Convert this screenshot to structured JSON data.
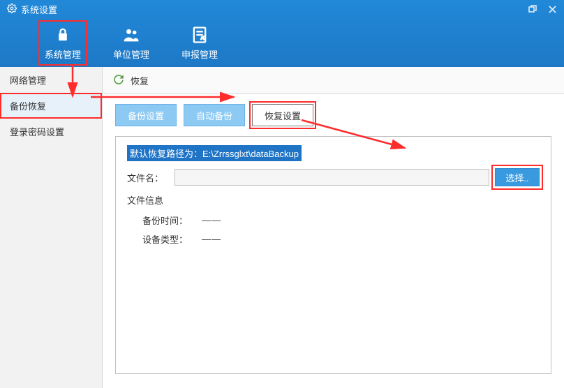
{
  "title": "系统设置",
  "toolbar": [
    {
      "key": "system-manage",
      "label": "系统管理",
      "highlight": true
    },
    {
      "key": "unit-manage",
      "label": "单位管理",
      "highlight": false
    },
    {
      "key": "report-manage",
      "label": "申报管理",
      "highlight": false
    }
  ],
  "sidebar": [
    {
      "key": "network",
      "label": "网络管理",
      "selected": false,
      "highlight": false
    },
    {
      "key": "backup-restore",
      "label": "备份恢复",
      "selected": true,
      "highlight": true
    },
    {
      "key": "password",
      "label": "登录密码设置",
      "selected": false,
      "highlight": false
    }
  ],
  "content_header": {
    "icon": "restore-icon",
    "title": "恢复"
  },
  "tabs": [
    {
      "key": "backup-settings",
      "label": "备份设置",
      "active": false,
      "highlight": false
    },
    {
      "key": "auto-backup",
      "label": "自动备份",
      "active": false,
      "highlight": false
    },
    {
      "key": "restore-settings",
      "label": "恢复设置",
      "active": true,
      "highlight": true
    }
  ],
  "panel": {
    "default_path_text": "默认恢复路径为：E:\\Zrrssglxt\\dataBackup",
    "filename_label": "文件名：",
    "filename_value": "",
    "choose_label": "选择..",
    "file_info_title": "文件信息",
    "backup_time_label": "备份时间：",
    "backup_time_value": "——",
    "device_type_label": "设备类型：",
    "device_type_value": "——"
  }
}
